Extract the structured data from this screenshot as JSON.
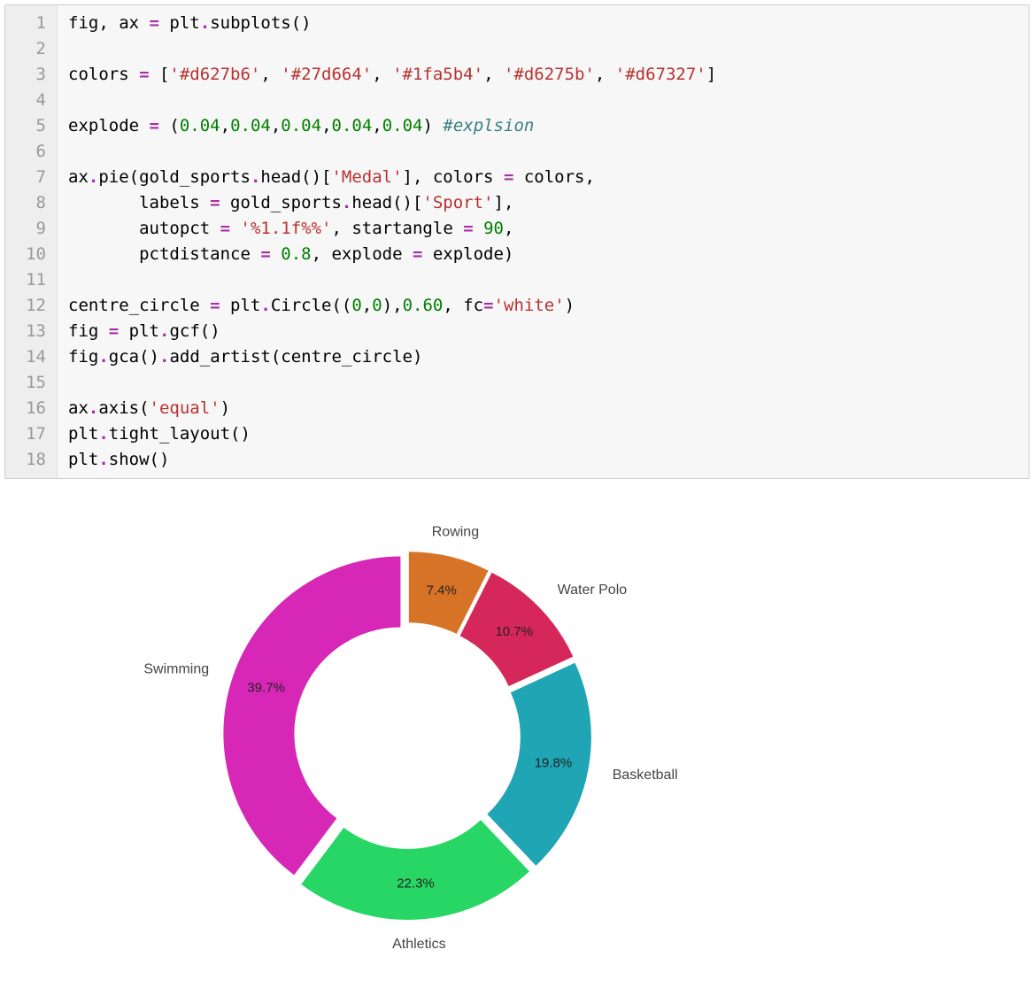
{
  "code": {
    "line_count": 18,
    "lines": [
      [
        {
          "t": "fig, ax ",
          "c": ""
        },
        {
          "t": "=",
          "c": "tok-op"
        },
        {
          "t": " plt",
          "c": ""
        },
        {
          "t": ".",
          "c": "tok-op"
        },
        {
          "t": "subplots()",
          "c": ""
        }
      ],
      [],
      [
        {
          "t": "colors ",
          "c": ""
        },
        {
          "t": "=",
          "c": "tok-op"
        },
        {
          "t": " [",
          "c": ""
        },
        {
          "t": "'#d627b6'",
          "c": "tok-str"
        },
        {
          "t": ", ",
          "c": ""
        },
        {
          "t": "'#27d664'",
          "c": "tok-str"
        },
        {
          "t": ", ",
          "c": ""
        },
        {
          "t": "'#1fa5b4'",
          "c": "tok-str"
        },
        {
          "t": ", ",
          "c": ""
        },
        {
          "t": "'#d6275b'",
          "c": "tok-str"
        },
        {
          "t": ", ",
          "c": ""
        },
        {
          "t": "'#d67327'",
          "c": "tok-str"
        },
        {
          "t": "]",
          "c": ""
        }
      ],
      [],
      [
        {
          "t": "explode ",
          "c": ""
        },
        {
          "t": "=",
          "c": "tok-op"
        },
        {
          "t": " (",
          "c": ""
        },
        {
          "t": "0.04",
          "c": "tok-num"
        },
        {
          "t": ",",
          "c": ""
        },
        {
          "t": "0.04",
          "c": "tok-num"
        },
        {
          "t": ",",
          "c": ""
        },
        {
          "t": "0.04",
          "c": "tok-num"
        },
        {
          "t": ",",
          "c": ""
        },
        {
          "t": "0.04",
          "c": "tok-num"
        },
        {
          "t": ",",
          "c": ""
        },
        {
          "t": "0.04",
          "c": "tok-num"
        },
        {
          "t": ") ",
          "c": ""
        },
        {
          "t": "#explsion",
          "c": "tok-com"
        }
      ],
      [],
      [
        {
          "t": "ax",
          "c": ""
        },
        {
          "t": ".",
          "c": "tok-op"
        },
        {
          "t": "pie(gold_sports",
          "c": ""
        },
        {
          "t": ".",
          "c": "tok-op"
        },
        {
          "t": "head()[",
          "c": ""
        },
        {
          "t": "'Medal'",
          "c": "tok-str"
        },
        {
          "t": "], colors ",
          "c": ""
        },
        {
          "t": "=",
          "c": "tok-op"
        },
        {
          "t": " colors,",
          "c": ""
        }
      ],
      [
        {
          "t": "       labels ",
          "c": ""
        },
        {
          "t": "=",
          "c": "tok-op"
        },
        {
          "t": " gold_sports",
          "c": ""
        },
        {
          "t": ".",
          "c": "tok-op"
        },
        {
          "t": "head()[",
          "c": ""
        },
        {
          "t": "'Sport'",
          "c": "tok-str"
        },
        {
          "t": "],",
          "c": ""
        }
      ],
      [
        {
          "t": "       autopct ",
          "c": ""
        },
        {
          "t": "=",
          "c": "tok-op"
        },
        {
          "t": " ",
          "c": ""
        },
        {
          "t": "'",
          "c": "tok-str"
        },
        {
          "t": "%1.1f%%",
          "c": "tok-str"
        },
        {
          "t": "'",
          "c": "tok-str"
        },
        {
          "t": ", startangle ",
          "c": ""
        },
        {
          "t": "=",
          "c": "tok-op"
        },
        {
          "t": " ",
          "c": ""
        },
        {
          "t": "90",
          "c": "tok-num"
        },
        {
          "t": ",",
          "c": ""
        }
      ],
      [
        {
          "t": "       pctdistance ",
          "c": ""
        },
        {
          "t": "=",
          "c": "tok-op"
        },
        {
          "t": " ",
          "c": ""
        },
        {
          "t": "0.8",
          "c": "tok-num"
        },
        {
          "t": ", explode ",
          "c": ""
        },
        {
          "t": "=",
          "c": "tok-op"
        },
        {
          "t": " explode)",
          "c": ""
        }
      ],
      [],
      [
        {
          "t": "centre_circle ",
          "c": ""
        },
        {
          "t": "=",
          "c": "tok-op"
        },
        {
          "t": " plt",
          "c": ""
        },
        {
          "t": ".",
          "c": "tok-op"
        },
        {
          "t": "Circle((",
          "c": ""
        },
        {
          "t": "0",
          "c": "tok-num"
        },
        {
          "t": ",",
          "c": ""
        },
        {
          "t": "0",
          "c": "tok-num"
        },
        {
          "t": "),",
          "c": ""
        },
        {
          "t": "0.60",
          "c": "tok-num"
        },
        {
          "t": ", fc",
          "c": ""
        },
        {
          "t": "=",
          "c": "tok-op"
        },
        {
          "t": "'white'",
          "c": "tok-str"
        },
        {
          "t": ")",
          "c": ""
        }
      ],
      [
        {
          "t": "fig ",
          "c": ""
        },
        {
          "t": "=",
          "c": "tok-op"
        },
        {
          "t": " plt",
          "c": ""
        },
        {
          "t": ".",
          "c": "tok-op"
        },
        {
          "t": "gcf()",
          "c": ""
        }
      ],
      [
        {
          "t": "fig",
          "c": ""
        },
        {
          "t": ".",
          "c": "tok-op"
        },
        {
          "t": "gca()",
          "c": ""
        },
        {
          "t": ".",
          "c": "tok-op"
        },
        {
          "t": "add_artist(centre_circle)",
          "c": ""
        }
      ],
      [],
      [
        {
          "t": "ax",
          "c": ""
        },
        {
          "t": ".",
          "c": "tok-op"
        },
        {
          "t": "axis(",
          "c": ""
        },
        {
          "t": "'equal'",
          "c": "tok-str"
        },
        {
          "t": ")",
          "c": ""
        }
      ],
      [
        {
          "t": "plt",
          "c": ""
        },
        {
          "t": ".",
          "c": "tok-op"
        },
        {
          "t": "tight_layout()",
          "c": ""
        }
      ],
      [
        {
          "t": "plt",
          "c": ""
        },
        {
          "t": ".",
          "c": "tok-op"
        },
        {
          "t": "show()",
          "c": ""
        }
      ]
    ]
  },
  "chart_data": {
    "type": "pie",
    "donut_inner_radius_ratio": 0.6,
    "startangle": 90,
    "explode": 0.04,
    "pctdistance": 0.8,
    "categories": [
      "Swimming",
      "Athletics",
      "Basketball",
      "Water Polo",
      "Rowing"
    ],
    "values": [
      39.7,
      22.3,
      19.8,
      10.7,
      7.4
    ],
    "pct_labels": [
      "39.7%",
      "22.3%",
      "19.8%",
      "10.7%",
      "7.4%"
    ],
    "colors": [
      "#d627b6",
      "#27d664",
      "#1fa5b4",
      "#d6275b",
      "#d67327"
    ]
  }
}
